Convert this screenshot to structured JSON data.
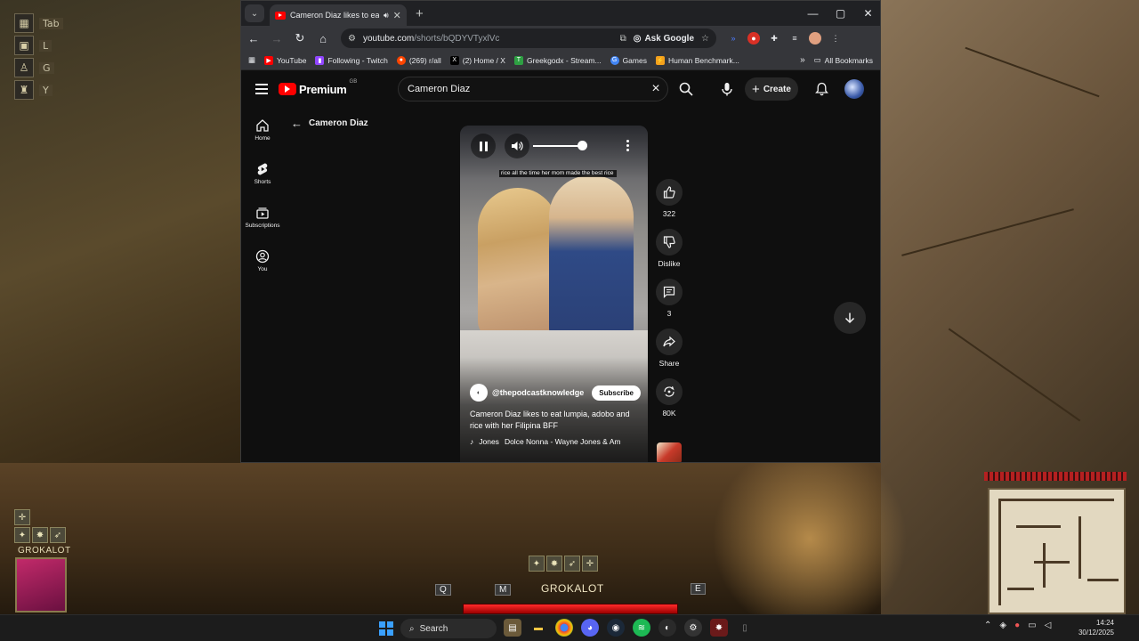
{
  "game": {
    "hud_keys": [
      "Tab",
      "L",
      "G",
      "Y"
    ],
    "character_name": "GROKALOT",
    "bottom_name": "GROKALOT",
    "bottom_keys": [
      "Q",
      "M",
      "E"
    ]
  },
  "browser": {
    "tab_title": "Cameron Diaz likes to eat lumpia",
    "url_host": "youtube.com",
    "url_path": "/shorts/bQDYVTyxlVc",
    "ask_google": "Ask Google",
    "bookmarks": [
      {
        "label": "YouTube",
        "color": "#ff0000"
      },
      {
        "label": "Following - Twitch",
        "color": "#9146ff"
      },
      {
        "label": "(269) r/all",
        "color": "#ff4500"
      },
      {
        "label": "(2) Home / X",
        "color": "#000000"
      },
      {
        "label": "Greekgodx - Stream...",
        "color": "#2ea043"
      },
      {
        "label": "Games",
        "color": "#4285f4"
      },
      {
        "label": "Human Benchmark...",
        "color": "#f4a11c"
      }
    ],
    "all_bookmarks": "All Bookmarks"
  },
  "youtube": {
    "logo": "Premium",
    "region": "GB",
    "search_value": "Cameron Diaz",
    "create_label": "Create",
    "nav": [
      {
        "label": "Home"
      },
      {
        "label": "Shorts"
      },
      {
        "label": "Subscriptions"
      },
      {
        "label": "You"
      }
    ],
    "back_title": "Cameron Diaz",
    "short": {
      "caption": "rice all the time her mom made the best rice",
      "channel": "@thepodcastknowledge",
      "subscribe": "Subscribe",
      "title": "Cameron Diaz likes to eat lumpia, adobo and rice with her Filipina BFF",
      "music_artist": "Jones",
      "music_track": "Dolce Nonna - Wayne Jones & Am",
      "volume": 0.95
    },
    "actions": {
      "likes": "322",
      "dislike": "Dislike",
      "comments": "3",
      "share": "Share",
      "remix": "80K"
    }
  },
  "taskbar": {
    "search": "Search",
    "time": "14:24",
    "date": "30/12/2025"
  }
}
